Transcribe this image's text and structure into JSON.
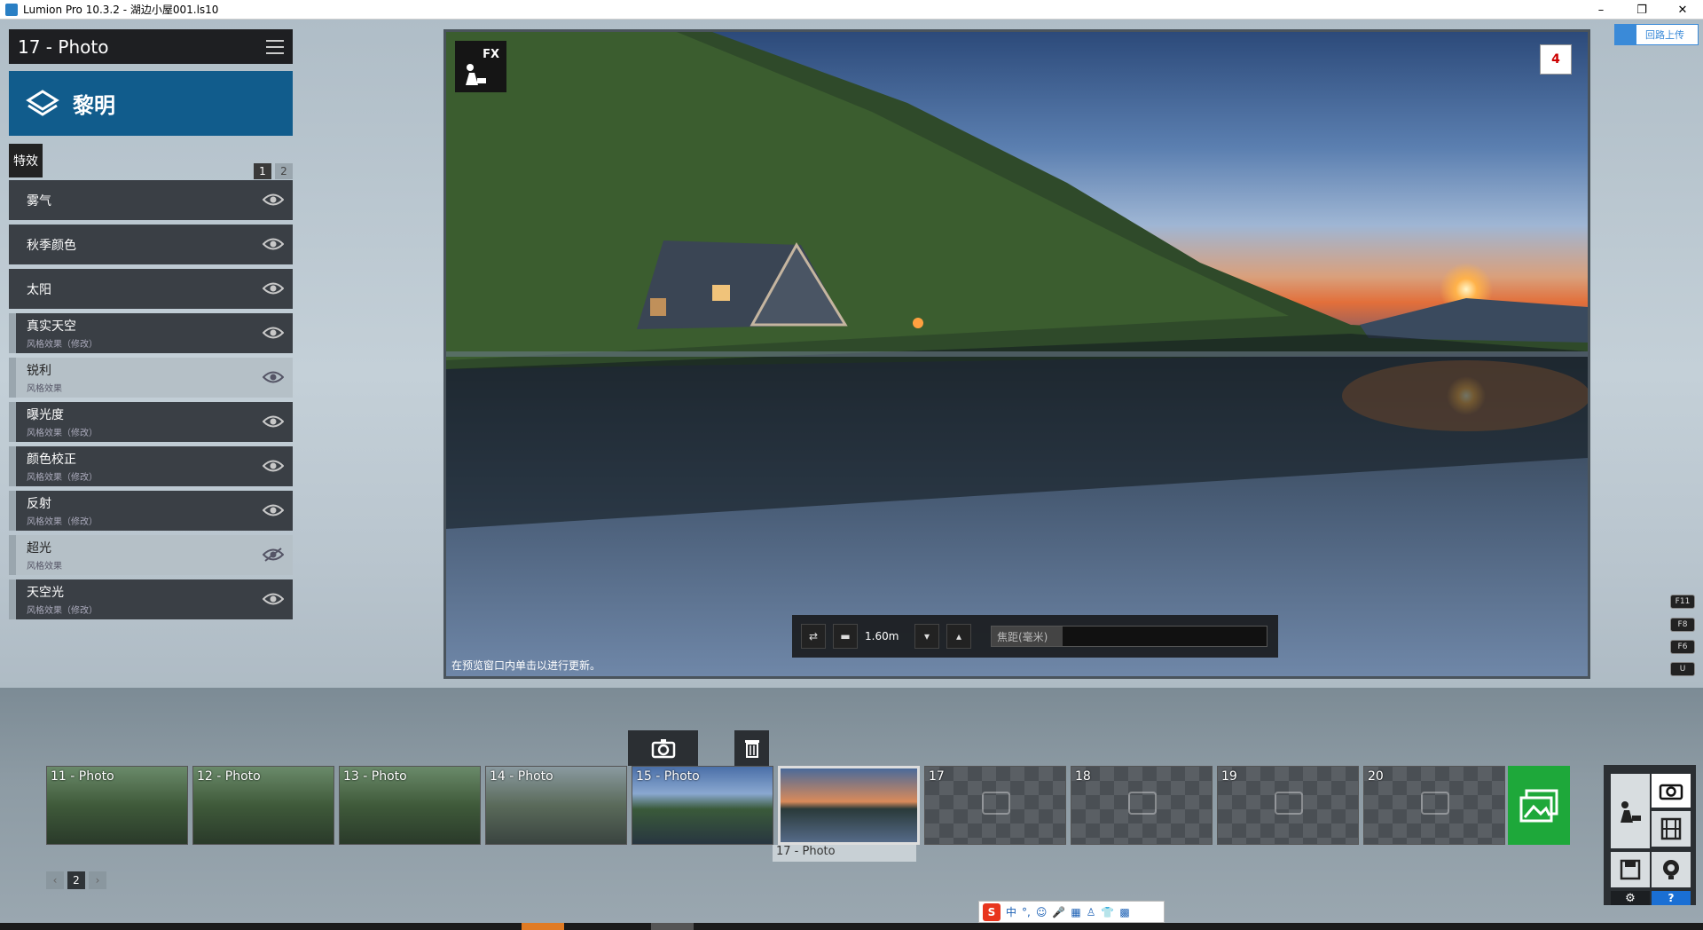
{
  "window": {
    "title": "Lumion Pro 10.3.2  - 湖边小屋001.ls10",
    "minimize": "–",
    "maximize": "❐",
    "close": "✕"
  },
  "left_panel": {
    "photo_title": "17 - Photo",
    "preset_name": "黎明",
    "fx_tab_label": "特效",
    "pages": [
      "1",
      "2"
    ],
    "effects": [
      {
        "name": "雾气",
        "sub": "",
        "style": "normal",
        "visible": true
      },
      {
        "name": "秋季颜色",
        "sub": "",
        "style": "normal",
        "visible": true
      },
      {
        "name": "太阳",
        "sub": "",
        "style": "normal",
        "visible": true
      },
      {
        "name": "真实天空",
        "sub": "风格效果（修改）",
        "style": "mod",
        "visible": true
      },
      {
        "name": "锐利",
        "sub": "风格效果",
        "style": "light",
        "visible": true
      },
      {
        "name": "曝光度",
        "sub": "风格效果（修改）",
        "style": "mod",
        "visible": true
      },
      {
        "name": "颜色校正",
        "sub": "风格效果（修改）",
        "style": "mod",
        "visible": true
      },
      {
        "name": "反射",
        "sub": "风格效果（修改）",
        "style": "mod",
        "visible": true
      },
      {
        "name": "超光",
        "sub": "风格效果",
        "style": "light",
        "visible": false
      },
      {
        "name": "天空光",
        "sub": "风格效果（修改）",
        "style": "mod",
        "visible": true
      }
    ]
  },
  "viewport": {
    "fx_badge": "FX",
    "corner_indicator": "4",
    "hint": "在预览窗口内单击以进行更新。",
    "camera_height": "1.60m",
    "focal_label": "焦距(毫米)"
  },
  "right_side": {
    "cloud_button": "回路上传",
    "fkeys": [
      "F11",
      "F8",
      "F6",
      "U"
    ]
  },
  "photos": [
    {
      "label": "11 - Photo",
      "state": "filled"
    },
    {
      "label": "12 - Photo",
      "state": "filled"
    },
    {
      "label": "13 - Photo",
      "state": "filled"
    },
    {
      "label": "14 - Photo",
      "state": "filled"
    },
    {
      "label": "15 - Photo",
      "state": "filled"
    },
    {
      "label": "",
      "state": "selected"
    },
    {
      "label": "17",
      "state": "empty"
    },
    {
      "label": "18",
      "state": "empty"
    },
    {
      "label": "19",
      "state": "empty"
    },
    {
      "label": "20",
      "state": "empty"
    }
  ],
  "selected_caption": "17 - Photo",
  "bottom_pages": [
    "‹",
    "2",
    "›"
  ],
  "mode_panel": {
    "help": "?"
  },
  "ime": {
    "logo": "S",
    "lang": "中"
  },
  "colors": {
    "banner": "#115c8c",
    "gallery_green": "#1ea83a",
    "mode_blue": "#1a6fd4"
  }
}
